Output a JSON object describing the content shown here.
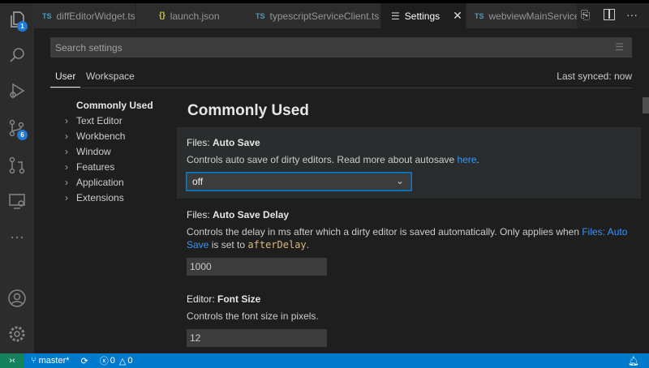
{
  "tabs": [
    {
      "label": "diffEditorWidget.ts",
      "type": "TS"
    },
    {
      "label": "launch.json",
      "type": "{}"
    },
    {
      "label": "typescriptServiceClient.ts",
      "type": "TS",
      "dirty": true
    },
    {
      "label": "Settings",
      "type": "settings-icon",
      "active": true
    },
    {
      "label": "webviewMainService.ts",
      "type": "TS"
    }
  ],
  "activity": {
    "explorer_badge": "1",
    "scm_badge": "6"
  },
  "search": {
    "placeholder": "Search settings"
  },
  "scope_tabs": {
    "user": "User",
    "workspace": "Workspace",
    "last_synced": "Last synced: now"
  },
  "toc": [
    "Commonly Used",
    "Text Editor",
    "Workbench",
    "Window",
    "Features",
    "Application",
    "Extensions"
  ],
  "section_title": "Commonly Used",
  "settings": [
    {
      "category": "Files: ",
      "name": "Auto Save",
      "desc": "Controls auto save of dirty editors. Read more about autosave ",
      "link": "here",
      "desc_end": ".",
      "value": "off"
    },
    {
      "category": "Files: ",
      "name": "Auto Save Delay",
      "desc": "Controls the delay in ms after which a dirty editor is saved automatically. Only applies when ",
      "link": "Files: Auto Save",
      "desc_mid": " is set to ",
      "code": "afterDelay",
      "desc_end": ".",
      "value": "1000"
    },
    {
      "category": "Editor: ",
      "name": "Font Size",
      "desc": "Controls the font size in pixels.",
      "value": "12"
    }
  ],
  "status": {
    "branch": "master*",
    "errors": "0",
    "warnings": "0"
  },
  "colors": {
    "accent": "#007acc",
    "remote": "#16825d"
  }
}
